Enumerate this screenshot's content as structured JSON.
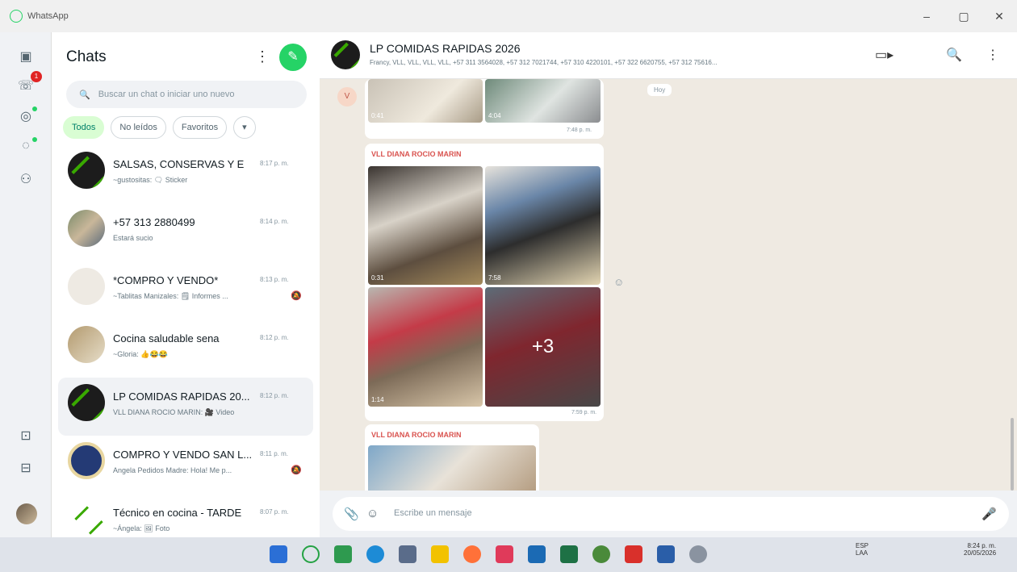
{
  "window": {
    "app_title": "WhatsApp",
    "minimize": "–",
    "restore": "▢",
    "close": "✕"
  },
  "rail": {
    "call_badge": "1"
  },
  "sidebar": {
    "title": "Chats",
    "menu_icon": "⋮",
    "new_chat_icon": "✎",
    "search": {
      "icon": "🔍",
      "placeholder": "Buscar un chat o iniciar uno nuevo"
    },
    "filters": [
      "Todos",
      "No leídos",
      "Favoritos"
    ],
    "filter_more": "▾",
    "chats": [
      {
        "name": "SALSAS, CONSERVAS Y E",
        "time": "8:17 p. m.",
        "preview": "~gustositas: 🗨 Sticker",
        "muted": false
      },
      {
        "name": "+57 313 2880499",
        "time": "8:14 p. m.",
        "preview": "Estará sucio",
        "muted": false
      },
      {
        "name": "*COMPRO Y VENDO*",
        "time": "8:13 p. m.",
        "preview": "~Tablitas Manizales: 🗒 Informes ...",
        "muted": true
      },
      {
        "name": "Cocina saludable sena",
        "time": "8:12 p. m.",
        "preview": "~Gloria: 👍😂😂",
        "muted": false
      },
      {
        "name": "LP COMIDAS RAPIDAS 20...",
        "time": "8:12 p. m.",
        "preview": "VLL DIANA ROCIO MARIN: 🎥 Video",
        "muted": false
      },
      {
        "name": "COMPRO Y VENDO SAN L...",
        "time": "8:11 p. m.",
        "preview": "Angela Pedidos Madre: Hola! Me p...",
        "muted": true
      },
      {
        "name": "Técnico en cocina - TARDE",
        "time": "8:07 p. m.",
        "preview": "~Ángela: 🖼 Foto",
        "muted": false
      }
    ]
  },
  "chat": {
    "group_name": "LP COMIDAS RAPIDAS 2026",
    "members": "Francy, VLL, VLL, VLL, VLL, +57 311 3564028, +57 312 7021744, +57 310 4220101, +57 322 6620755, +57 312 75616...",
    "date_pill": "Hoy",
    "v_tag": "V",
    "top_album": {
      "durations": [
        "0:41",
        "4:04"
      ],
      "time": "7:48 p. m."
    },
    "album": {
      "sender": "VLL DIANA ROCIO MARIN",
      "durations": [
        "0:31",
        "7:58",
        "1:14"
      ],
      "more": "+3",
      "time": "7:59 p. m."
    },
    "bottom": {
      "sender": "VLL DIANA ROCIO MARIN"
    },
    "react_icon": "☺",
    "composer": {
      "attach_icon": "📎",
      "sticker_icon": "☺",
      "placeholder": "Escribe un mensaje",
      "mic_icon": "🎤"
    },
    "video_icon": "▭▸",
    "search_icon": "🔍",
    "menu_icon": "⋮"
  },
  "taskbar": {
    "lang": "ESP",
    "layout": "LAA",
    "time": "8:24 p. m.",
    "date": "20/05/2026"
  }
}
